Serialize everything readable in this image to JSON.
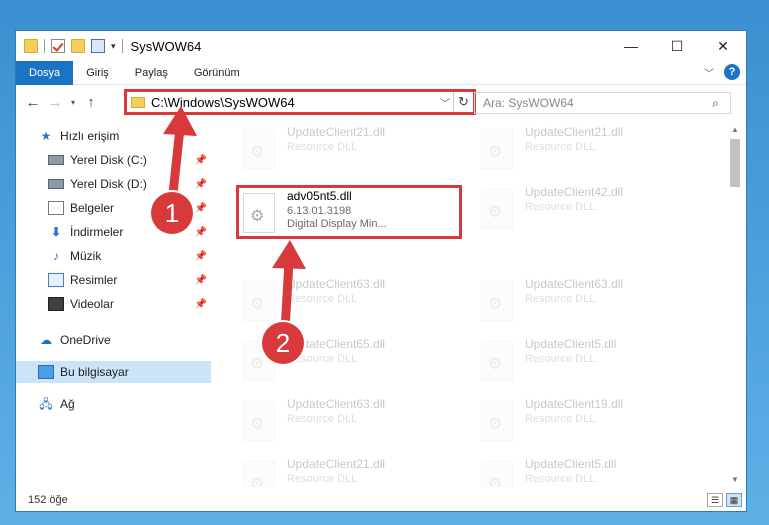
{
  "window": {
    "title": "SysWOW64",
    "controls": {
      "minimize": "—",
      "maximize": "☐",
      "close": "✕"
    }
  },
  "ribbon": {
    "tabs": [
      "Dosya",
      "Giriş",
      "Paylaş",
      "Görünüm"
    ],
    "active_tab": "Dosya",
    "help": "?"
  },
  "address": {
    "path": "C:\\Windows\\SysWOW64",
    "search_placeholder": "Ara: SysWOW64"
  },
  "nav": {
    "quick_access": "Hızlı erişim",
    "items": [
      {
        "label": "Yerel Disk (C:)",
        "icon": "disk-icon",
        "pinned": true
      },
      {
        "label": "Yerel Disk (D:)",
        "icon": "disk-icon",
        "pinned": true
      },
      {
        "label": "Belgeler",
        "icon": "documents-icon",
        "pinned": true
      },
      {
        "label": "İndirmeler",
        "icon": "download-icon",
        "pinned": true
      },
      {
        "label": "Müzik",
        "icon": "music-icon",
        "pinned": true
      },
      {
        "label": "Resimler",
        "icon": "pictures-icon",
        "pinned": true
      },
      {
        "label": "Videolar",
        "icon": "videos-icon",
        "pinned": true
      }
    ],
    "onedrive": "OneDrive",
    "this_pc": "Bu bilgisayar",
    "network": "Ağ"
  },
  "files": {
    "left": [
      {
        "name": "UpdateClient21.dll",
        "sub": "Resource DLL",
        "faded": true
      },
      {
        "name": "adv05nt5.dll",
        "sub": "6.13.01.3198",
        "sub2": "Digital Display Min...",
        "faded": false
      },
      {
        "name": "UpdateClient63.dll",
        "sub": "Resource DLL",
        "faded": true
      },
      {
        "name": "UpdateClient65.dll",
        "sub": "Resource DLL",
        "faded": true
      },
      {
        "name": "UpdateClient63.dll",
        "sub": "Resource DLL",
        "faded": true
      },
      {
        "name": "UpdateClient21.dll",
        "sub": "Resource DLL",
        "faded": true
      }
    ],
    "right": [
      {
        "name": "UpdateClient21.dll",
        "sub": "Resource DLL"
      },
      {
        "name": "UpdateClient42.dll",
        "sub": "Resource DLL"
      },
      {
        "name": "UpdateClient63.dll",
        "sub": "Resource DLL"
      },
      {
        "name": "UpdateClient5.dll",
        "sub": "Resource DLL"
      },
      {
        "name": "UpdateClient19.dll",
        "sub": "Resource DLL"
      },
      {
        "name": "UpdateClient5.dll",
        "sub": "Resource DLL"
      }
    ]
  },
  "status": {
    "count": "152 öğe"
  },
  "annotations": {
    "badge1": "1",
    "badge2": "2",
    "color": "#d8393a"
  }
}
